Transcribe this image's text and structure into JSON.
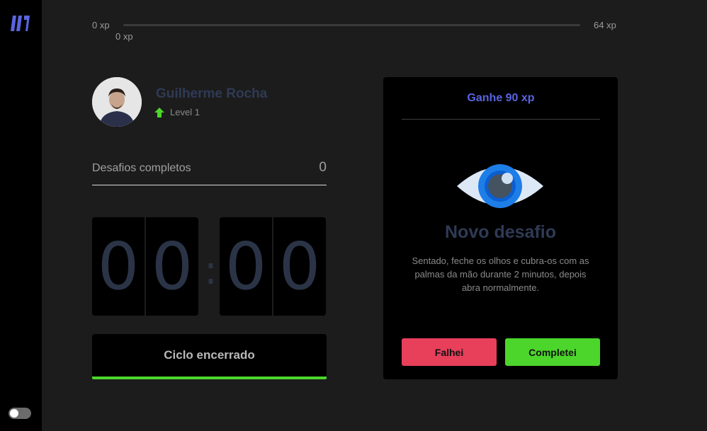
{
  "xp": {
    "start_label": "0 xp",
    "end_label": "64 xp",
    "current_label": "0 xp",
    "progress": 0
  },
  "profile": {
    "name": "Guilherme Rocha",
    "level_label": "Level 1",
    "level_icon": "level-up-arrow-icon"
  },
  "challenges": {
    "label": "Desafios completos",
    "count": "0"
  },
  "countdown": {
    "minutes": [
      "0",
      "0"
    ],
    "seconds": [
      "0",
      "0"
    ],
    "separator": ":"
  },
  "cycle_button": {
    "label": "Ciclo encerrado"
  },
  "challenge_card": {
    "reward": "Ganhe 90 xp",
    "icon": "eye-icon",
    "title": "Novo desafio",
    "description": "Sentado, feche os olhos e cubra-os com as palmas da mão durante 2 minutos, depois abra normalmente.",
    "fail_label": "Falhei",
    "complete_label": "Completei"
  },
  "colors": {
    "accent": "#5965e0",
    "green": "#4cd62b",
    "red": "#e83f5b",
    "background": "#1c1c1c",
    "panel": "#000000"
  }
}
